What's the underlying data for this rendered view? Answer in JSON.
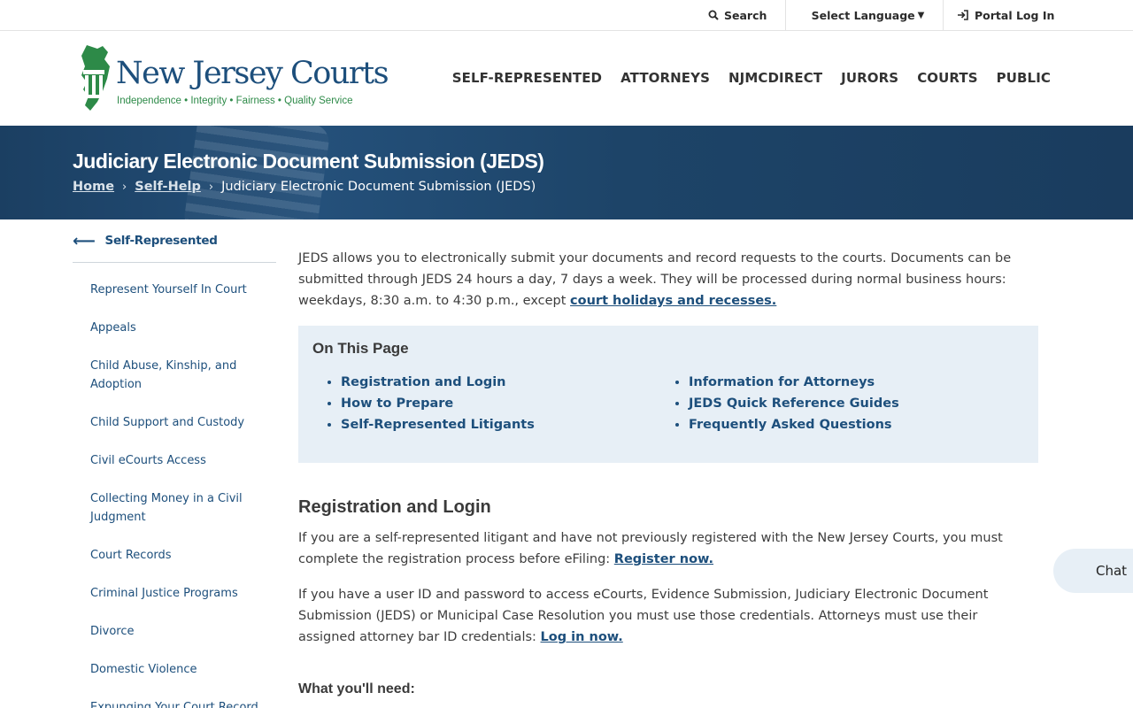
{
  "utility": {
    "search_label": "Search",
    "language_label": "Select Language",
    "portal_label": "Portal Log In"
  },
  "header": {
    "logo_title": "New Jersey Courts",
    "logo_tagline": "Independence • Integrity • Fairness • Quality Service",
    "nav": [
      "SELF-REPRESENTED",
      "ATTORNEYS",
      "NJMCDIRECT",
      "JURORS",
      "COURTS",
      "PUBLIC"
    ]
  },
  "hero": {
    "title": "Judiciary Electronic Document Submission (JEDS)",
    "breadcrumbs": [
      "Home",
      "Self-Help",
      "Judiciary Electronic Document Submission (JEDS)"
    ]
  },
  "sidebar": {
    "back_label": "Self-Represented",
    "items": [
      "Represent Yourself In Court",
      "Appeals",
      "Child Abuse, Kinship, and Adoption",
      "Child Support and Custody",
      "Civil eCourts Access",
      "Collecting Money in a Civil Judgment",
      "Court Records",
      "Criminal Justice Programs",
      "Divorce",
      "Domestic Violence",
      "Expunging Your Court Record"
    ]
  },
  "content": {
    "intro_text": "JEDS allows you to electronically submit your documents and record requests to the courts. Documents can be submitted through JEDS 24 hours a day, 7 days a week. They will be processed during normal business hours: weekdays, 8:30 a.m. to 4:30 p.m., except ",
    "intro_link": "court holidays and recesses.",
    "on_this_page_title": "On This Page",
    "otp_left": [
      "Registration and Login",
      "How to Prepare",
      "Self-Represented Litigants"
    ],
    "otp_right": [
      "Information for Attorneys",
      "JEDS Quick Reference Guides",
      "Frequently Asked Questions"
    ],
    "section_title": "Registration and Login",
    "para1_text": "If you are a self-represented litigant and have not previously registered with the New Jersey Courts, you must complete the registration process before eFiling: ",
    "para1_link": "Register now.",
    "para2_text": "If you have a user ID and password to access eCourts, Evidence Submission, Judiciary Electronic Document Submission (JEDS) or Municipal Case Resolution you must use those credentials. Attorneys must use their assigned attorney bar ID credentials: ",
    "para2_link": "Log in now.",
    "subheading": "What you'll need:"
  },
  "chat": {
    "label": "Chat"
  },
  "colors": {
    "brand_blue": "#1d4f7c",
    "brand_green": "#2d8a48",
    "hero_bg": "#1b3f62",
    "panel_bg": "#e7eff6"
  }
}
